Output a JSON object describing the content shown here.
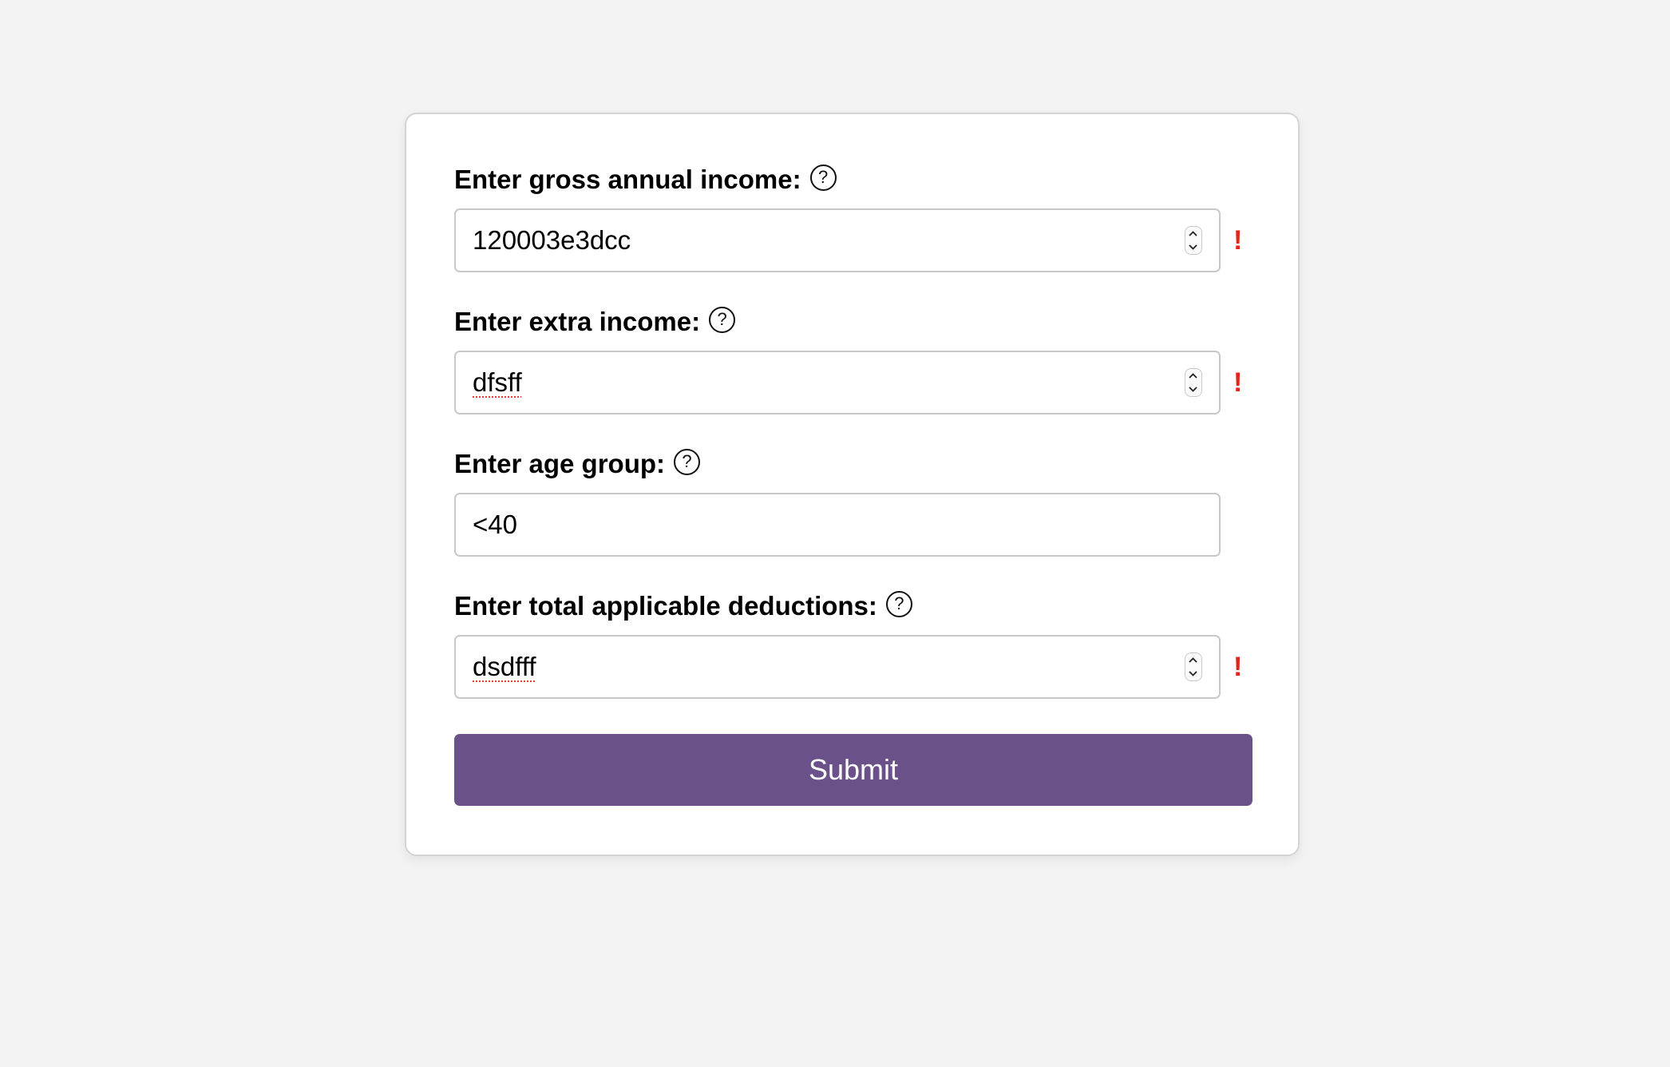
{
  "form": {
    "fields": [
      {
        "label": "Enter gross annual income:",
        "value": "120003e3dcc",
        "help_icon": "?",
        "error": "!"
      },
      {
        "label": "Enter extra income:",
        "value": "dfsff",
        "help_icon": "?",
        "error": "!"
      },
      {
        "label": "Enter age group:",
        "value": "<40",
        "help_icon": "?"
      },
      {
        "label": "Enter total applicable deductions:",
        "value": "dsdfff",
        "help_icon": "?",
        "error": "!"
      }
    ],
    "submit_label": "Submit"
  },
  "colors": {
    "page_background": "#f3f3f3",
    "card_background": "#ffffff",
    "accent_button": "#6b5189",
    "error": "#e0261c"
  },
  "icons": {
    "help": "question-circle-icon",
    "error": "exclamation-icon",
    "spinner": "number-spinner"
  }
}
